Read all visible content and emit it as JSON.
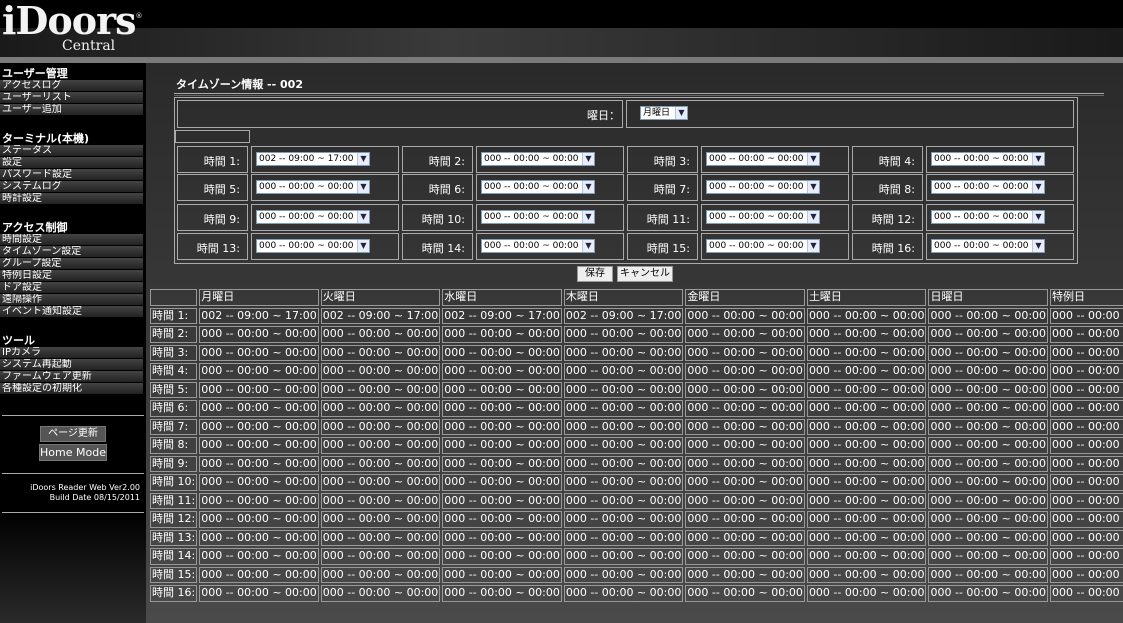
{
  "header": {
    "logo_brand": "iDoors",
    "logo_reg": "®",
    "logo_sub": "Central"
  },
  "sidebar": {
    "sections": [
      {
        "title": "ユーザー管理",
        "items": [
          "アクセスログ",
          "ユーザーリスト",
          "ユーザー追加"
        ]
      },
      {
        "title": "ターミナル(本機)",
        "items": [
          "ステータス",
          "設定",
          "パスワード設定",
          "システムログ",
          "時計設定"
        ]
      },
      {
        "title": "アクセス制御",
        "items": [
          "時間設定",
          "タイムゾーン設定",
          "グループ設定",
          "特例日設定",
          "ドア設定",
          "遠隔操作",
          "イベント通知設定"
        ]
      },
      {
        "title": "ツール",
        "items": [
          "IPカメラ",
          "システム再起動",
          "ファームウェア更新",
          "各種設定の初期化"
        ]
      }
    ],
    "refresh_label": "ページ更新",
    "home_label": "Home Mode",
    "version_line1": "iDoors Reader Web Ver2.00",
    "version_line2": "Build Date 08/15/2011"
  },
  "main": {
    "title": "タイムゾーン情報 -- 002",
    "weekday_label": "曜日：",
    "weekday_value": "月曜日",
    "slots": [
      {
        "label": "時間 1:",
        "value": "002 -- 09:00 ~ 17:00"
      },
      {
        "label": "時間 2:",
        "value": "000 -- 00:00 ~ 00:00"
      },
      {
        "label": "時間 3:",
        "value": "000 -- 00:00 ~ 00:00"
      },
      {
        "label": "時間 4:",
        "value": "000 -- 00:00 ~ 00:00"
      },
      {
        "label": "時間 5:",
        "value": "000 -- 00:00 ~ 00:00"
      },
      {
        "label": "時間 6:",
        "value": "000 -- 00:00 ~ 00:00"
      },
      {
        "label": "時間 7:",
        "value": "000 -- 00:00 ~ 00:00"
      },
      {
        "label": "時間 8:",
        "value": "000 -- 00:00 ~ 00:00"
      },
      {
        "label": "時間 9:",
        "value": "000 -- 00:00 ~ 00:00"
      },
      {
        "label": "時間 10:",
        "value": "000 -- 00:00 ~ 00:00"
      },
      {
        "label": "時間 11:",
        "value": "000 -- 00:00 ~ 00:00"
      },
      {
        "label": "時間 12:",
        "value": "000 -- 00:00 ~ 00:00"
      },
      {
        "label": "時間 13:",
        "value": "000 -- 00:00 ~ 00:00"
      },
      {
        "label": "時間 14:",
        "value": "000 -- 00:00 ~ 00:00"
      },
      {
        "label": "時間 15:",
        "value": "000 -- 00:00 ~ 00:00"
      },
      {
        "label": "時間 16:",
        "value": "000 -- 00:00 ~ 00:00"
      }
    ],
    "save_label": "保存",
    "cancel_label": "キャンセル",
    "schedule": {
      "columns": [
        "月曜日",
        "火曜日",
        "水曜日",
        "木曜日",
        "金曜日",
        "土曜日",
        "日曜日",
        "特例日"
      ],
      "row_labels": [
        "時間 1:",
        "時間 2:",
        "時間 3:",
        "時間 4:",
        "時間 5:",
        "時間 6:",
        "時間 7:",
        "時間 8:",
        "時間 9:",
        "時間 10:",
        "時間 11:",
        "時間 12:",
        "時間 13:",
        "時間 14:",
        "時間 15:",
        "時間 16:"
      ],
      "first_row": [
        "002 -- 09:00 ~ 17:00",
        "002 -- 09:00 ~ 17:00",
        "002 -- 09:00 ~ 17:00",
        "002 -- 09:00 ~ 17:00",
        "000 -- 00:00 ~ 00:00",
        "000 -- 00:00 ~ 00:00",
        "000 -- 00:00 ~ 00:00",
        "000 -- 00:00 ~ 00:00"
      ],
      "empty_value": "000 -- 00:00 ~ 00:00"
    }
  }
}
